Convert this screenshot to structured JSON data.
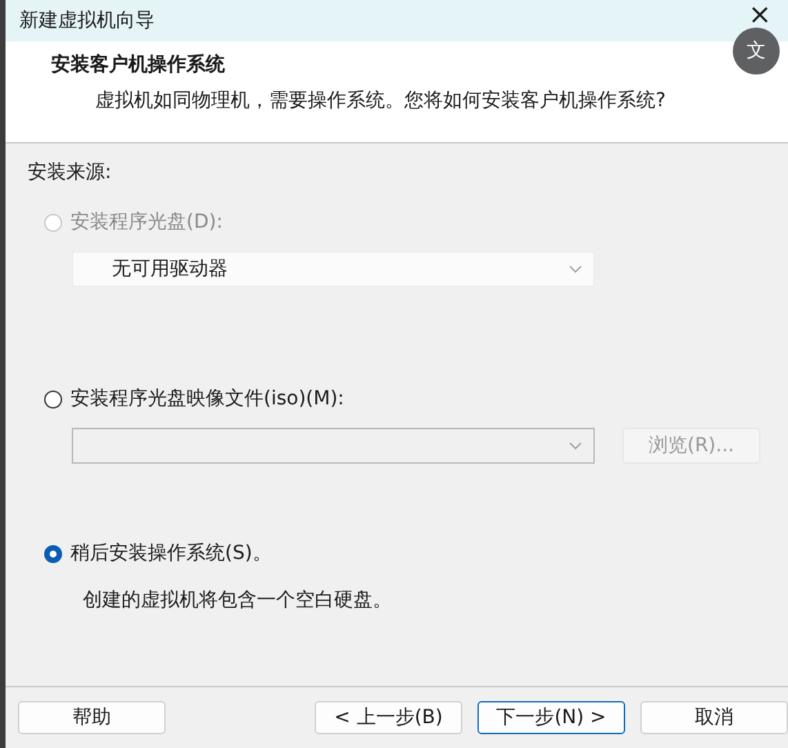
{
  "window": {
    "title": "新建虚拟机向导",
    "close": "×"
  },
  "translate_button": {
    "label": "文"
  },
  "header": {
    "title": "安装客户机操作系统",
    "subtitle": "虚拟机如同物理机，需要操作系统。您将如何安装客户机操作系统?"
  },
  "source_label": "安装来源:",
  "options": [
    {
      "kind": "drive",
      "label": "安装程序光盘(D):",
      "selected": false,
      "disabled": true,
      "dropdown": {
        "value": "无可用驱动器",
        "disabled": true
      }
    },
    {
      "kind": "image",
      "label": "安装程序光盘映像文件(iso)(M):",
      "selected": false,
      "disabled": false,
      "dropdown": {
        "disabled": true
      },
      "browse": {
        "label": "浏览(R)...",
        "disabled": true
      }
    },
    {
      "kind": "later",
      "label": "稍后安装操作系统(S)。",
      "selected": true,
      "disabled": false,
      "description": "创建的虚拟机将包含一个空白硬盘。"
    }
  ],
  "buttons": [
    {
      "label": "帮助",
      "focused": false
    },
    {
      "label": "< 上一步(B)",
      "focused": false
    },
    {
      "label": "下一步(N) >",
      "focused": true
    },
    {
      "label": "取消",
      "focused": false
    }
  ]
}
